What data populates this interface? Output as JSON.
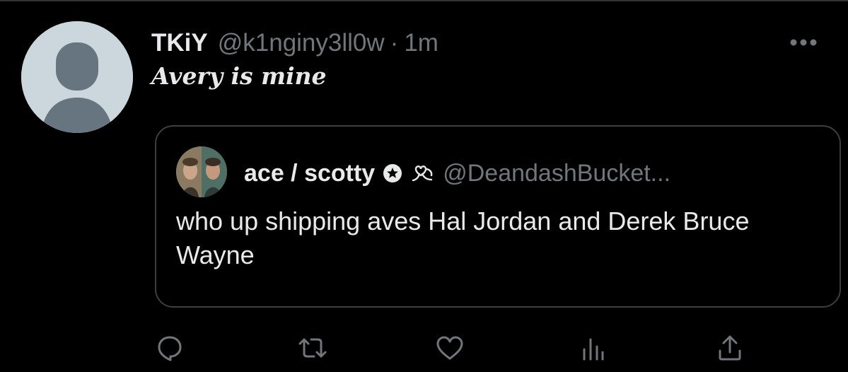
{
  "tweet": {
    "display_name": "TKiY",
    "handle": "@k1nginy3ll0w",
    "separator": "·",
    "timestamp": "1m",
    "text": "Avery is mine"
  },
  "quoted_tweet": {
    "display_name": "ace / scotty",
    "handle": "@DeandashBucket...",
    "text": "who up shipping aves Hal Jordan and Derek Bruce Wayne"
  },
  "icons": {
    "more": "more-horizontal-icon",
    "reply": "reply-bubble-icon",
    "retweet": "retweet-icon",
    "like": "heart-icon",
    "analytics": "analytics-bars-icon",
    "share": "share-upload-icon",
    "badge": "star-badge-icon",
    "emoji": "heart-ribbon-emoji-icon"
  },
  "colors": {
    "background": "#000000",
    "primary_text": "#e7e9ea",
    "secondary_text": "#71767b",
    "border": "#3a3f44",
    "default_avatar": "#ccd6dd"
  }
}
